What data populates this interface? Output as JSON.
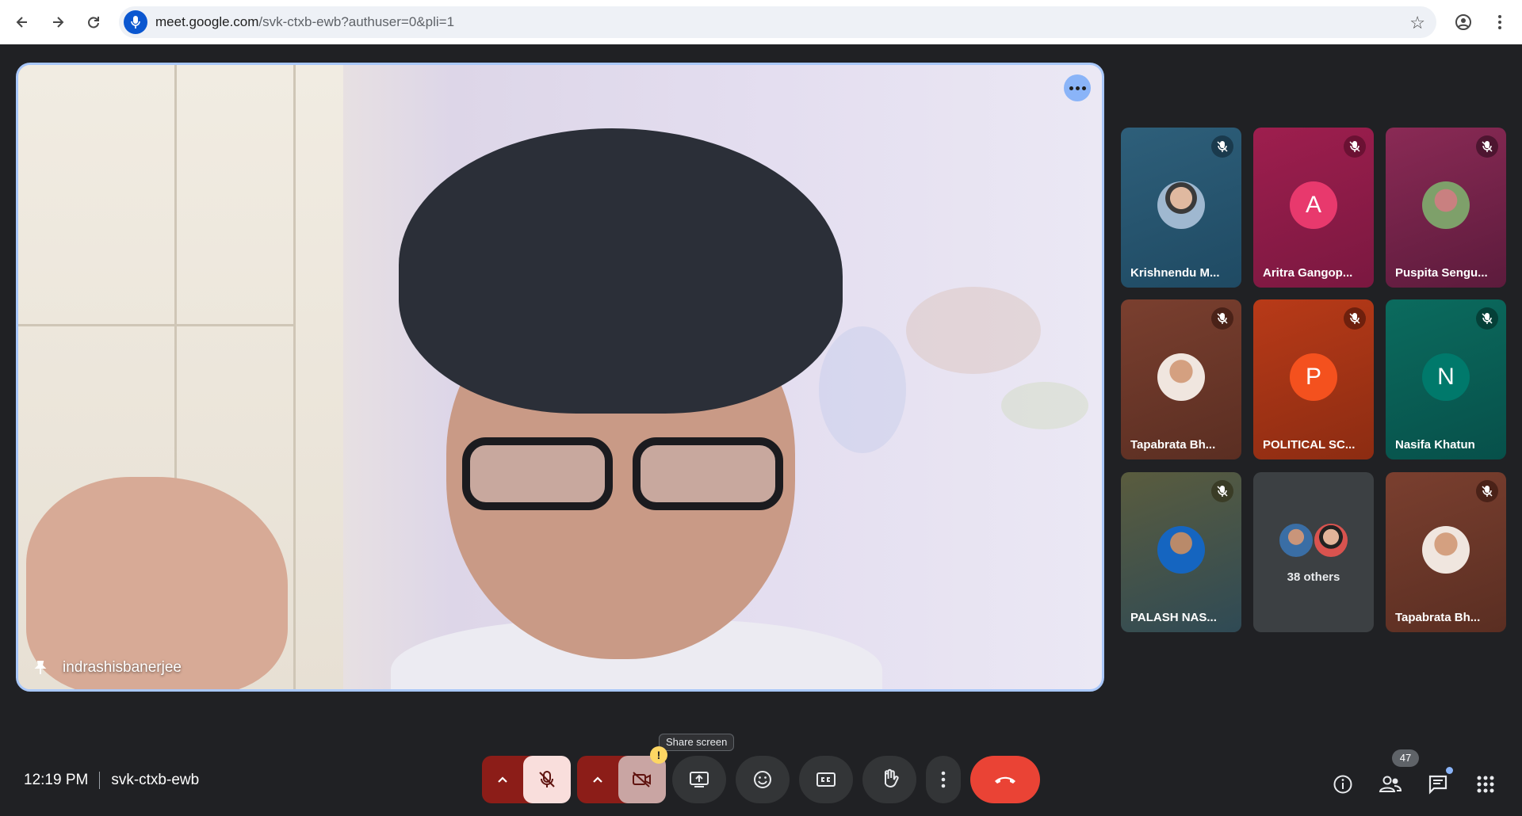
{
  "browser": {
    "url_host": "meet.google.com",
    "url_path": "/svk-ctxb-ewb?authuser=0&pli=1"
  },
  "main_tile": {
    "name": "indrashisbanerjee"
  },
  "participants": [
    {
      "name": "Krishnendu M...",
      "initial": "",
      "color": "#2e5f7a"
    },
    {
      "name": "Aritra Gangop...",
      "initial": "A",
      "color": "#e8396d"
    },
    {
      "name": "Puspita Sengu...",
      "initial": "",
      "color": "#8a2a55"
    },
    {
      "name": "Tapabrata Bh...",
      "initial": "",
      "color": "#7a3f2f"
    },
    {
      "name": "POLITICAL SC...",
      "initial": "P",
      "color": "#f4511e"
    },
    {
      "name": "Nasifa Khatun",
      "initial": "N",
      "color": "#00796b"
    },
    {
      "name": "PALASH NAS...",
      "initial": "",
      "color": "#5a6a4a"
    },
    {
      "name": "Tapabrata Bh...",
      "initial": "",
      "color": "#7a3f2f"
    }
  ],
  "others": {
    "label": "38 others"
  },
  "bottom_bar": {
    "time": "12:19 PM",
    "meeting_code": "svk-ctxb-ewb",
    "tooltip": "Share screen",
    "people_count": "47",
    "warning_glyph": "!"
  },
  "colors": {
    "end_call": "#ea4335",
    "muted_bg": "#f9dedc",
    "dark_red": "#8c1d18",
    "accent_blue": "#a8c7fa"
  }
}
